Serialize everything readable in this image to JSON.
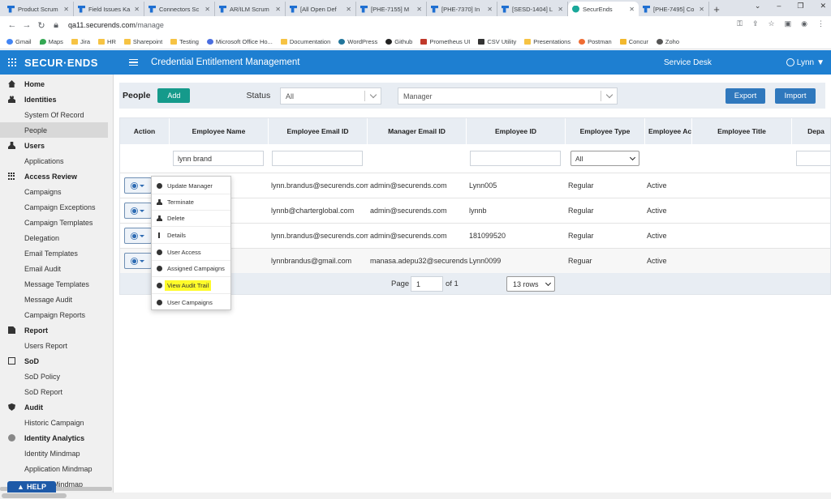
{
  "browser": {
    "tabs": [
      {
        "label": "Product Scrum",
        "active": false
      },
      {
        "label": "Field Issues Ka",
        "active": false
      },
      {
        "label": "Connectors Sc",
        "active": false
      },
      {
        "label": "AR/ILM Scrum",
        "active": false
      },
      {
        "label": "[All Open Def",
        "active": false
      },
      {
        "label": "[PHE-7155] M",
        "active": false
      },
      {
        "label": "[PHE-7370] In",
        "active": false
      },
      {
        "label": "[SESD-1404] L",
        "active": false
      },
      {
        "label": "SecurEnds",
        "active": true
      },
      {
        "label": "[PHE-7495] Co",
        "active": false
      }
    ],
    "url_host": "qa11.securends.com",
    "url_path": "/manage",
    "bookmarks": [
      {
        "label": "Gmail",
        "icon": "g"
      },
      {
        "label": "Maps",
        "icon": "map"
      },
      {
        "label": "Jira",
        "icon": "folder"
      },
      {
        "label": "HR",
        "icon": "folder"
      },
      {
        "label": "Sharepoint",
        "icon": "folder"
      },
      {
        "label": "Testing",
        "icon": "folder"
      },
      {
        "label": "Microsoft Office Ho...",
        "icon": "ms"
      },
      {
        "label": "Documentation",
        "icon": "folder"
      },
      {
        "label": "WordPress",
        "icon": "wp"
      },
      {
        "label": "Github",
        "icon": "gh"
      },
      {
        "label": "Prometheus UI",
        "icon": "pr"
      },
      {
        "label": "CSV Utility",
        "icon": "csv"
      },
      {
        "label": "Presentations",
        "icon": "folder"
      },
      {
        "label": "Postman",
        "icon": "pm"
      },
      {
        "label": "Concur",
        "icon": "cc"
      },
      {
        "label": "Zoho",
        "icon": "zo"
      }
    ]
  },
  "header": {
    "logo": "SECUR·ENDS",
    "title": "Credential Entitlement Management",
    "service_desk": "Service Desk",
    "user": "Lynn",
    "accent_color": "#1e7fd1"
  },
  "sidebar": {
    "items": [
      {
        "type": "section",
        "label": "Home",
        "icon": "home"
      },
      {
        "type": "section",
        "label": "Identities",
        "icon": "people"
      },
      {
        "type": "item",
        "label": "System Of Record"
      },
      {
        "type": "item",
        "label": "People",
        "active": true
      },
      {
        "type": "section",
        "label": "Users",
        "icon": "user"
      },
      {
        "type": "item",
        "label": "Applications"
      },
      {
        "type": "section",
        "label": "Access Review",
        "icon": "gridi"
      },
      {
        "type": "item",
        "label": "Campaigns"
      },
      {
        "type": "item",
        "label": "Campaign Exceptions"
      },
      {
        "type": "item",
        "label": "Campaign Templates"
      },
      {
        "type": "item",
        "label": "Delegation"
      },
      {
        "type": "item",
        "label": "Email Templates"
      },
      {
        "type": "item",
        "label": "Email Audit"
      },
      {
        "type": "item",
        "label": "Message Templates"
      },
      {
        "type": "item",
        "label": "Message Audit"
      },
      {
        "type": "item",
        "label": "Campaign Reports"
      },
      {
        "type": "section",
        "label": "Report",
        "icon": "report"
      },
      {
        "type": "item",
        "label": "Users Report"
      },
      {
        "type": "section",
        "label": "SoD",
        "icon": "sod"
      },
      {
        "type": "item",
        "label": "SoD Policy"
      },
      {
        "type": "item",
        "label": "SoD Report"
      },
      {
        "type": "section",
        "label": "Audit",
        "icon": "shield"
      },
      {
        "type": "item",
        "label": "Historic Campaign"
      },
      {
        "type": "section",
        "label": "Identity Analytics",
        "icon": "dot"
      },
      {
        "type": "item",
        "label": "Identity Mindmap"
      },
      {
        "type": "item",
        "label": "Application Mindmap"
      },
      {
        "type": "item",
        "label": "Account Mindmap"
      }
    ],
    "help": "HELP"
  },
  "toolbar": {
    "title": "People",
    "add_label": "Add",
    "status_label": "Status",
    "status_value": "All",
    "manager_placeholder": "Manager",
    "export_label": "Export",
    "import_label": "Import"
  },
  "table": {
    "columns": [
      "Action",
      "Employee Name",
      "Employee Email ID",
      "Manager Email ID",
      "Employee ID",
      "Employee Type",
      "Employee Ac",
      "Employee Title",
      "Depa"
    ],
    "filters": {
      "employee_name": "lynn brand",
      "employee_type": "All"
    },
    "rows": [
      {
        "email": "lynn.brandus@securends.com",
        "manager": "admin@securends.com",
        "emp_id": "Lynn005",
        "type": "Regular",
        "status": "Active"
      },
      {
        "email": "lynnb@charterglobal.com",
        "manager": "admin@securends.com",
        "emp_id": "lynnb",
        "type": "Regular",
        "status": "Active"
      },
      {
        "email": "lynn.brandus@securends.com",
        "manager": "admin@securends.com",
        "emp_id": "181099520",
        "type": "Regular",
        "status": "Active"
      },
      {
        "email": "lynnbrandus@gmail.com",
        "manager": "manasa.adepu32@securends",
        "emp_id": "Lynn0099",
        "type": "Reguar",
        "status": "Active"
      }
    ],
    "pagination": {
      "page_label": "Page",
      "page_value": "1",
      "of_label": "of 1",
      "rows_per_page": "13 rows"
    }
  },
  "action_menu": [
    {
      "label": "Update Manager",
      "icon": "circ"
    },
    {
      "label": "Terminate",
      "icon": "person"
    },
    {
      "label": "Delete",
      "icon": "person"
    },
    {
      "label": "Details",
      "icon": "info"
    },
    {
      "label": "User Access",
      "icon": "circ"
    },
    {
      "label": "Assigned Campaigns",
      "icon": "circ"
    },
    {
      "label": "View Audit Trail",
      "icon": "circ",
      "highlighted": true
    },
    {
      "label": "User Campaigns",
      "icon": "circ"
    }
  ]
}
